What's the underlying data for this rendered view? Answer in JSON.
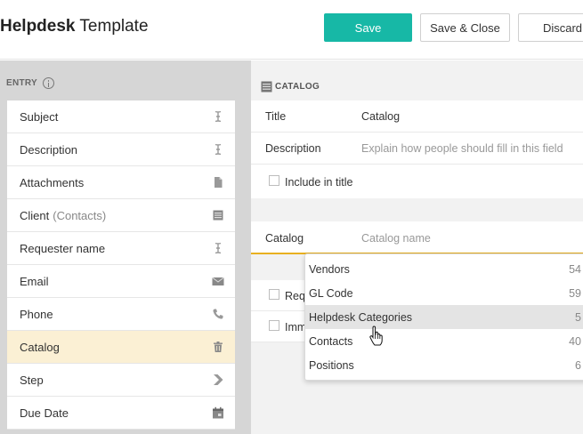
{
  "header": {
    "title_bold": "Helpdesk",
    "title_rest": " Template",
    "save_label": "Save",
    "save_close_label": "Save & Close",
    "discard_label": "Discard"
  },
  "entry": {
    "heading": "ENTRY",
    "fields": [
      {
        "label": "Subject",
        "icon": "text-field-icon"
      },
      {
        "label": "Description",
        "icon": "text-field-icon"
      },
      {
        "label": "Attachments",
        "icon": "document-icon"
      },
      {
        "label": "Client",
        "sub": "(Contacts)",
        "icon": "catalog-icon"
      },
      {
        "label": "Requester name",
        "icon": "text-field-icon"
      },
      {
        "label": "Email",
        "icon": "envelope-icon"
      },
      {
        "label": "Phone",
        "icon": "phone-icon"
      },
      {
        "label": "Catalog",
        "icon": "trash-icon",
        "active": true
      },
      {
        "label": "Step",
        "icon": "chevron-right-icon"
      },
      {
        "label": "Due Date",
        "icon": "calendar-icon"
      }
    ]
  },
  "props": {
    "heading": "CATALOG",
    "title_label": "Title",
    "title_value": "Catalog",
    "description_label": "Description",
    "description_placeholder": "Explain how people should fill in this field",
    "include_in_title_label": "Include in title",
    "catalog_label": "Catalog",
    "catalog_placeholder": "Catalog name",
    "required_label_partial": "Req",
    "immutable_label_partial": "Imm"
  },
  "dropdown": {
    "items": [
      {
        "label": "Vendors",
        "count": "54"
      },
      {
        "label": "GL Code",
        "count": "59"
      },
      {
        "label": "Helpdesk Categories",
        "count": "5",
        "hover": true
      },
      {
        "label": "Contacts",
        "count": "40"
      },
      {
        "label": "Positions",
        "count": "6"
      }
    ]
  },
  "colors": {
    "accent": "#17b8a6",
    "active_row": "#fbf0d4",
    "underline": "#e8b020"
  }
}
